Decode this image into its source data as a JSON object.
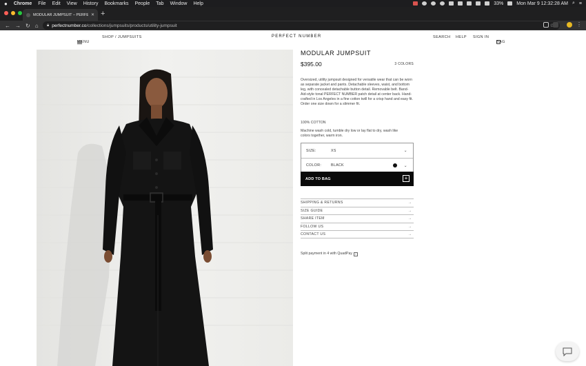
{
  "menubar": {
    "apple": "",
    "app": "Chrome",
    "menus": [
      "File",
      "Edit",
      "View",
      "History",
      "Bookmarks",
      "People",
      "Tab",
      "Window",
      "Help"
    ],
    "battery": "33%",
    "datetime": "Mon Mar 9  12:32:28 AM"
  },
  "browser": {
    "tab_title": "MODULAR JUMPSUIT – PERFECT NUMBER",
    "new_tab": "+",
    "url_host": "perfectnumber.co",
    "url_path": "/collections/jumpsuits/products/utility-jumpsuit",
    "traffic_colors": [
      "#ff5f57",
      "#febc2e",
      "#28c840"
    ]
  },
  "site": {
    "menu": "MENU",
    "breadcrumb": "SHOP / JUMPSUITS",
    "brand": "PERFECT NUMBER",
    "search": "SEARCH",
    "help": "HELP",
    "sign_in": "SIGN IN",
    "bag": "BAG"
  },
  "product": {
    "title": "MODULAR JUMPSUIT",
    "price": "$395.00",
    "colors_count": "3 COLORS",
    "description": "Oversized, utility jumpsuit designed for versatile wear that can be worn as separate jacket and pants. Detachable sleeves, waist, and bottom leg, with concealed detachable button detail. Removable belt. Band-Aid-style tonal PERFECT NUMBER patch detail at center back. Hand-crafted in Los Angeles in a fine cotton twill for a crisp hand and easy fit. Order one size down for a slimmer fit.",
    "material": "100% COTTON",
    "care": "Machine wash cold, tumble dry low or lay flat to dry, wash like colors together, warm iron.",
    "size_label": "SIZE:",
    "size_value": "XS",
    "color_label": "COLOR:",
    "color_value": "BLACK",
    "swatch_color": "#111111",
    "add_to_bag": "ADD TO BAG",
    "accordion": [
      "SHIPPING & RETURNS",
      "SIZE GUIDE",
      "SHARE ITEM",
      "FOLLOW US",
      "CONTACT US"
    ],
    "quadpay": "Split payment in 4 with QuadPay"
  }
}
